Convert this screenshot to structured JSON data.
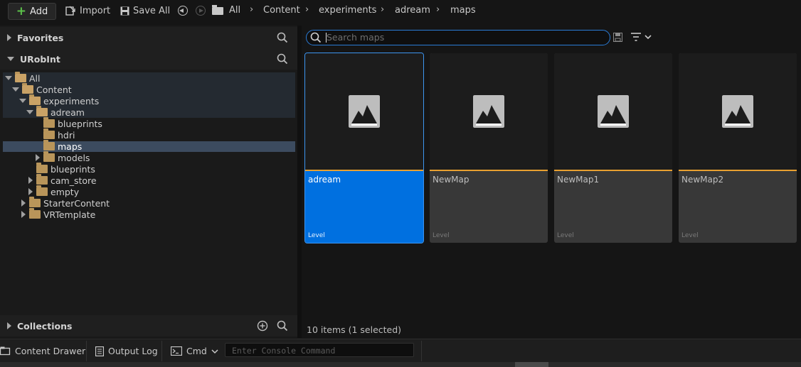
{
  "toolbar": {
    "add_label": "Add",
    "import_label": "Import",
    "save_all_label": "Save All",
    "breadcrumbs": [
      "All",
      "Content",
      "experiments",
      "adream",
      "maps"
    ]
  },
  "left_panel": {
    "favorites_title": "Favorites",
    "project_title": "URobInt",
    "collections_title": "Collections",
    "tree": [
      {
        "label": "All"
      },
      {
        "label": "Content"
      },
      {
        "label": "experiments"
      },
      {
        "label": "adream"
      },
      {
        "label": "blueprints"
      },
      {
        "label": "hdri"
      },
      {
        "label": "maps"
      },
      {
        "label": "models"
      },
      {
        "label": "blueprints"
      },
      {
        "label": "cam_store"
      },
      {
        "label": "empty"
      },
      {
        "label": "StarterContent"
      },
      {
        "label": "VRTemplate"
      }
    ]
  },
  "search": {
    "placeholder": "Search maps"
  },
  "assets": [
    {
      "name": "adream",
      "type": "Level"
    },
    {
      "name": "NewMap",
      "type": "Level"
    },
    {
      "name": "NewMap1",
      "type": "Level"
    },
    {
      "name": "NewMap2",
      "type": "Level"
    }
  ],
  "status": {
    "item_count": "10 items (1 selected)"
  },
  "bottom_bar": {
    "content_drawer_label": "Content Drawer",
    "output_log_label": "Output Log",
    "cmd_label": "Cmd",
    "console_placeholder": "Enter Console Command"
  },
  "colors": {
    "accent": "#0070e0",
    "level_bar": "#e8a030",
    "folder": "#b9955a"
  }
}
